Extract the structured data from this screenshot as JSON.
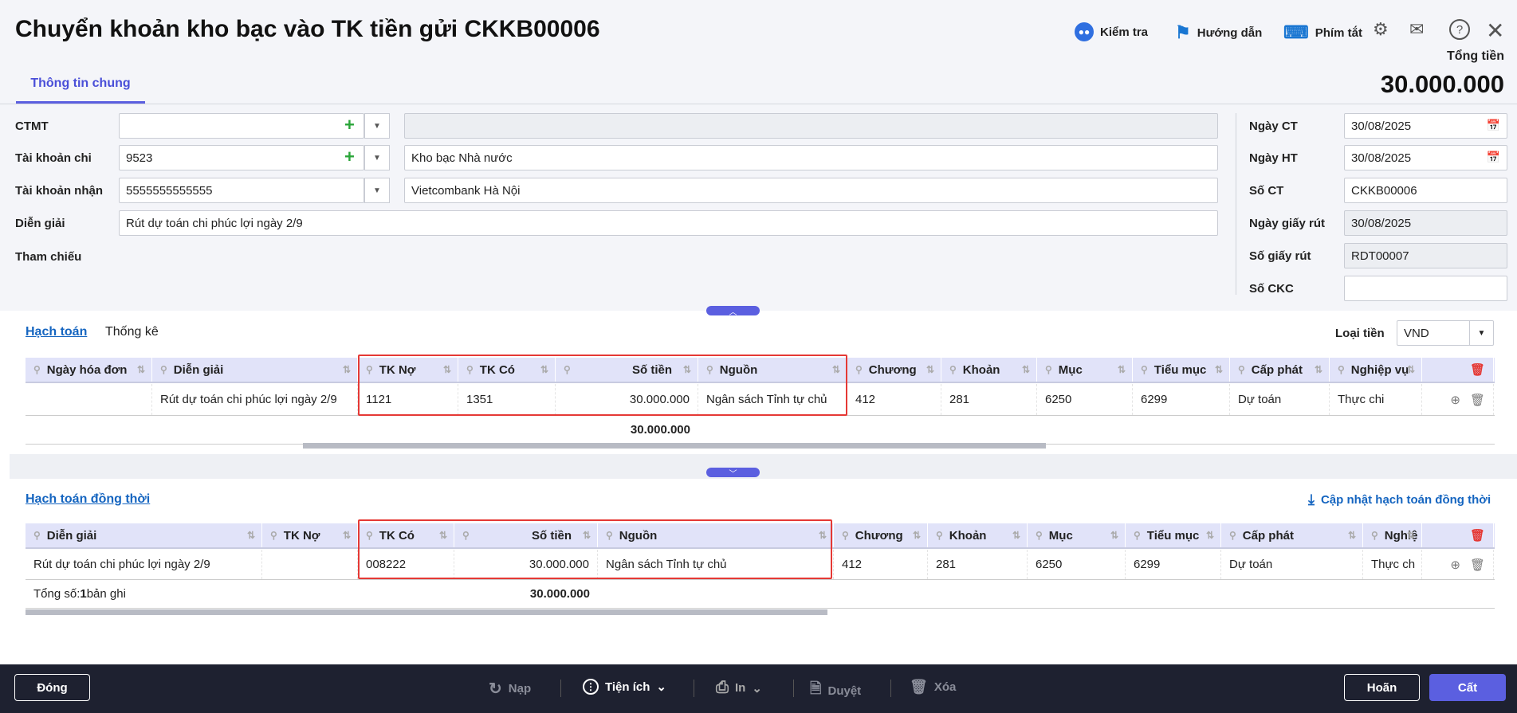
{
  "header": {
    "title": "Chuyển khoản kho bạc vào TK tiền gửi CKKB00006",
    "tools": {
      "check": "Kiểm tra",
      "guide": "Hướng dẫn",
      "shortcuts": "Phím tắt"
    },
    "total_label": "Tổng tiền",
    "total_value": "30.000.000",
    "tab": "Thông tin chung"
  },
  "form": {
    "ctmt": {
      "label": "CTMT",
      "value": "",
      "name": ""
    },
    "tk_chi": {
      "label": "Tài khoản chi",
      "value": "9523",
      "name": "Kho bạc Nhà nước"
    },
    "tk_nhan": {
      "label": "Tài khoản nhận",
      "value": "5555555555555",
      "name": "Vietcombank Hà Nội"
    },
    "dien_giai": {
      "label": "Diễn giải",
      "value": "Rút dự toán chi phúc lợi ngày 2/9"
    },
    "tham_chieu": {
      "label": "Tham chiếu"
    }
  },
  "right_form": [
    {
      "label": "Ngày CT",
      "value": "30/08/2025",
      "icon": "calendar"
    },
    {
      "label": "Ngày HT",
      "value": "30/08/2025",
      "icon": "calendar"
    },
    {
      "label": "Số CT",
      "value": "CKKB00006"
    },
    {
      "label": "Ngày giấy rút",
      "value": "30/08/2025",
      "disabled": true
    },
    {
      "label": "Số giấy rút",
      "value": "RDT00007",
      "disabled": true
    },
    {
      "label": "Số CKC",
      "value": ""
    }
  ],
  "grid1": {
    "tabs": [
      "Hạch toán",
      "Thống kê"
    ],
    "currency_label": "Loại tiền",
    "currency": "VND",
    "columns": [
      "Ngày hóa đơn",
      "Diễn giải",
      "TK Nợ",
      "TK Có",
      "Số tiền",
      "Nguồn",
      "Chương",
      "Khoản",
      "Mục",
      "Tiểu mục",
      "Cấp phát",
      "Nghiệp vụ"
    ],
    "rows": [
      [
        "",
        "Rút dự toán chi phúc lợi ngày 2/9",
        "1121",
        "1351",
        "30.000.000",
        "Ngân sách Tỉnh tự chủ",
        "412",
        "281",
        "6250",
        "6299",
        "Dự toán",
        "Thực chi"
      ]
    ],
    "total": "30.000.000"
  },
  "grid2": {
    "title": "Hạch toán đồng thời",
    "update_link": "Cập nhật hạch toán đồng thời",
    "columns": [
      "Diễn giải",
      "TK Nợ",
      "TK Có",
      "Số tiền",
      "Nguồn",
      "Chương",
      "Khoản",
      "Mục",
      "Tiểu mục",
      "Cấp phát",
      "Nghiệ"
    ],
    "rows": [
      [
        "Rút dự toán chi phúc lợi ngày 2/9",
        "",
        "008222",
        "30.000.000",
        "Ngân sách Tỉnh tự chủ",
        "412",
        "281",
        "6250",
        "6299",
        "Dự toán",
        "Thực ch"
      ]
    ],
    "total_prefix": "Tổng số: ",
    "total_count": "1",
    "total_suffix": " bản ghi",
    "total": "30.000.000"
  },
  "footer": {
    "close": "Đóng",
    "reload": "Nạp",
    "utilities": "Tiện ích",
    "print": "In",
    "approve": "Duyệt",
    "delete": "Xóa",
    "defer": "Hoãn",
    "save": "Cất"
  }
}
